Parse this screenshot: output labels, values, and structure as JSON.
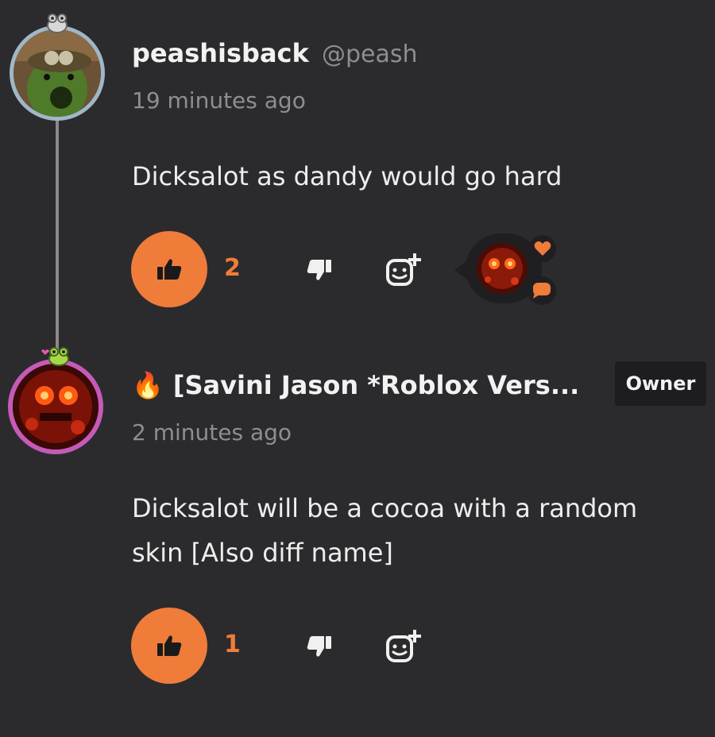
{
  "comments": [
    {
      "username": "peashisback",
      "handle": "@peash",
      "time": "19 minutes ago",
      "text": "Dicksalot as dandy would go hard",
      "like_count": "2",
      "reactions": [
        "heart",
        "chat"
      ]
    },
    {
      "username": "[Savini Jason *Roblox Vers...",
      "name_emoji": "🔥",
      "badge": "Owner",
      "time": "2 minutes ago",
      "text_line1": "Dicksalot will be a cocoa with a random",
      "text_line2": "skin [Also diff name]",
      "like_count": "1"
    }
  ],
  "colors": {
    "background": "#2b2b2e",
    "accent": "#f07c3a",
    "muted": "#8e8e92"
  },
  "icons": [
    "thumbs-up-icon",
    "thumbs-down-icon",
    "add-reaction-icon",
    "heart-icon",
    "chat-bubble-icon",
    "fire-icon",
    "frog-badge-icon"
  ]
}
